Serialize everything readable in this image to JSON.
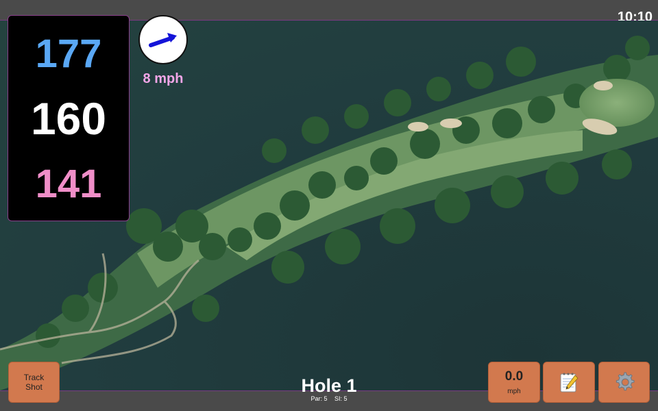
{
  "status": {
    "time": "10:10"
  },
  "yardage": {
    "back": "177",
    "center": "160",
    "front": "141"
  },
  "wind": {
    "speed": "8 mph",
    "direction_icon": "arrow-icon"
  },
  "hole": {
    "title": "Hole 1",
    "par": "Par: 5",
    "si": "SI: 5"
  },
  "buttons": {
    "track_shot_line1": "Track",
    "track_shot_line2": "Shot",
    "speed_value": "0.0",
    "speed_unit": "mph",
    "notes_icon": "notepad-icon",
    "settings_icon": "gear-icon"
  },
  "colors": {
    "back_yardage": "#5aa8f5",
    "center_yardage": "#ffffff",
    "front_yardage": "#f08ec8",
    "button": "#d2794e"
  }
}
